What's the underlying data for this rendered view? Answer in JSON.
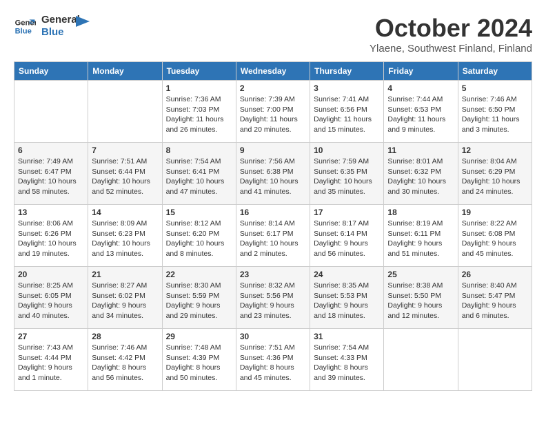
{
  "logo": {
    "line1": "General",
    "line2": "Blue"
  },
  "title": "October 2024",
  "location": "Ylaene, Southwest Finland, Finland",
  "days_of_week": [
    "Sunday",
    "Monday",
    "Tuesday",
    "Wednesday",
    "Thursday",
    "Friday",
    "Saturday"
  ],
  "weeks": [
    [
      {
        "day": "",
        "info": ""
      },
      {
        "day": "",
        "info": ""
      },
      {
        "day": "1",
        "info": "Sunrise: 7:36 AM\nSunset: 7:03 PM\nDaylight: 11 hours\nand 26 minutes."
      },
      {
        "day": "2",
        "info": "Sunrise: 7:39 AM\nSunset: 7:00 PM\nDaylight: 11 hours\nand 20 minutes."
      },
      {
        "day": "3",
        "info": "Sunrise: 7:41 AM\nSunset: 6:56 PM\nDaylight: 11 hours\nand 15 minutes."
      },
      {
        "day": "4",
        "info": "Sunrise: 7:44 AM\nSunset: 6:53 PM\nDaylight: 11 hours\nand 9 minutes."
      },
      {
        "day": "5",
        "info": "Sunrise: 7:46 AM\nSunset: 6:50 PM\nDaylight: 11 hours\nand 3 minutes."
      }
    ],
    [
      {
        "day": "6",
        "info": "Sunrise: 7:49 AM\nSunset: 6:47 PM\nDaylight: 10 hours\nand 58 minutes."
      },
      {
        "day": "7",
        "info": "Sunrise: 7:51 AM\nSunset: 6:44 PM\nDaylight: 10 hours\nand 52 minutes."
      },
      {
        "day": "8",
        "info": "Sunrise: 7:54 AM\nSunset: 6:41 PM\nDaylight: 10 hours\nand 47 minutes."
      },
      {
        "day": "9",
        "info": "Sunrise: 7:56 AM\nSunset: 6:38 PM\nDaylight: 10 hours\nand 41 minutes."
      },
      {
        "day": "10",
        "info": "Sunrise: 7:59 AM\nSunset: 6:35 PM\nDaylight: 10 hours\nand 35 minutes."
      },
      {
        "day": "11",
        "info": "Sunrise: 8:01 AM\nSunset: 6:32 PM\nDaylight: 10 hours\nand 30 minutes."
      },
      {
        "day": "12",
        "info": "Sunrise: 8:04 AM\nSunset: 6:29 PM\nDaylight: 10 hours\nand 24 minutes."
      }
    ],
    [
      {
        "day": "13",
        "info": "Sunrise: 8:06 AM\nSunset: 6:26 PM\nDaylight: 10 hours\nand 19 minutes."
      },
      {
        "day": "14",
        "info": "Sunrise: 8:09 AM\nSunset: 6:23 PM\nDaylight: 10 hours\nand 13 minutes."
      },
      {
        "day": "15",
        "info": "Sunrise: 8:12 AM\nSunset: 6:20 PM\nDaylight: 10 hours\nand 8 minutes."
      },
      {
        "day": "16",
        "info": "Sunrise: 8:14 AM\nSunset: 6:17 PM\nDaylight: 10 hours\nand 2 minutes."
      },
      {
        "day": "17",
        "info": "Sunrise: 8:17 AM\nSunset: 6:14 PM\nDaylight: 9 hours\nand 56 minutes."
      },
      {
        "day": "18",
        "info": "Sunrise: 8:19 AM\nSunset: 6:11 PM\nDaylight: 9 hours\nand 51 minutes."
      },
      {
        "day": "19",
        "info": "Sunrise: 8:22 AM\nSunset: 6:08 PM\nDaylight: 9 hours\nand 45 minutes."
      }
    ],
    [
      {
        "day": "20",
        "info": "Sunrise: 8:25 AM\nSunset: 6:05 PM\nDaylight: 9 hours\nand 40 minutes."
      },
      {
        "day": "21",
        "info": "Sunrise: 8:27 AM\nSunset: 6:02 PM\nDaylight: 9 hours\nand 34 minutes."
      },
      {
        "day": "22",
        "info": "Sunrise: 8:30 AM\nSunset: 5:59 PM\nDaylight: 9 hours\nand 29 minutes."
      },
      {
        "day": "23",
        "info": "Sunrise: 8:32 AM\nSunset: 5:56 PM\nDaylight: 9 hours\nand 23 minutes."
      },
      {
        "day": "24",
        "info": "Sunrise: 8:35 AM\nSunset: 5:53 PM\nDaylight: 9 hours\nand 18 minutes."
      },
      {
        "day": "25",
        "info": "Sunrise: 8:38 AM\nSunset: 5:50 PM\nDaylight: 9 hours\nand 12 minutes."
      },
      {
        "day": "26",
        "info": "Sunrise: 8:40 AM\nSunset: 5:47 PM\nDaylight: 9 hours\nand 6 minutes."
      }
    ],
    [
      {
        "day": "27",
        "info": "Sunrise: 7:43 AM\nSunset: 4:44 PM\nDaylight: 9 hours\nand 1 minute."
      },
      {
        "day": "28",
        "info": "Sunrise: 7:46 AM\nSunset: 4:42 PM\nDaylight: 8 hours\nand 56 minutes."
      },
      {
        "day": "29",
        "info": "Sunrise: 7:48 AM\nSunset: 4:39 PM\nDaylight: 8 hours\nand 50 minutes."
      },
      {
        "day": "30",
        "info": "Sunrise: 7:51 AM\nSunset: 4:36 PM\nDaylight: 8 hours\nand 45 minutes."
      },
      {
        "day": "31",
        "info": "Sunrise: 7:54 AM\nSunset: 4:33 PM\nDaylight: 8 hours\nand 39 minutes."
      },
      {
        "day": "",
        "info": ""
      },
      {
        "day": "",
        "info": ""
      }
    ]
  ]
}
